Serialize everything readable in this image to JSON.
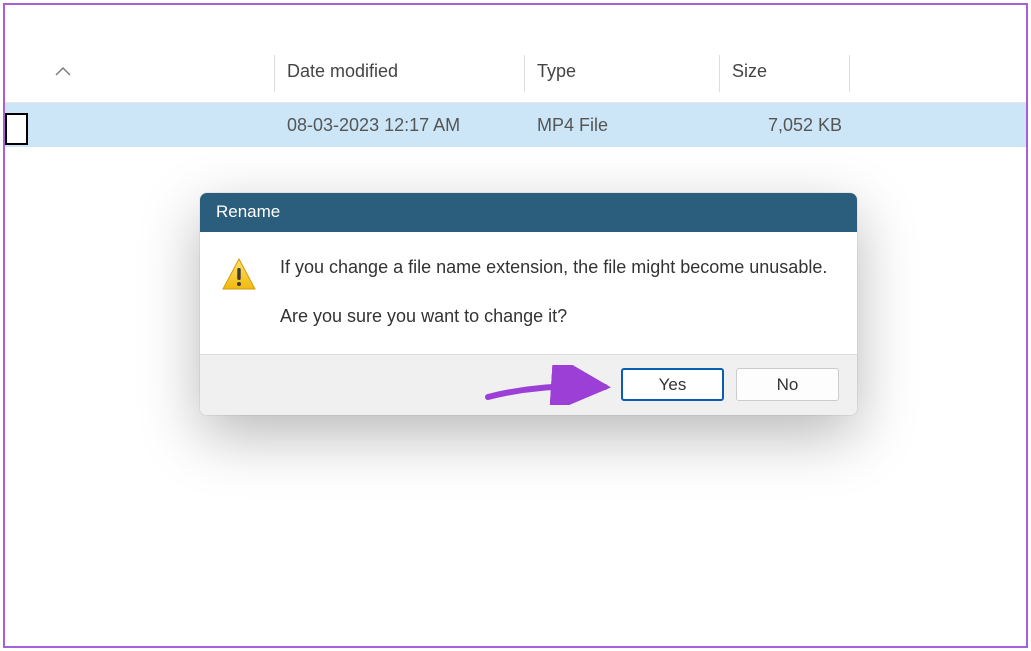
{
  "columns": {
    "name": "",
    "date": "Date modified",
    "type": "Type",
    "size": "Size"
  },
  "row": {
    "date": "08-03-2023 12:17 AM",
    "type": "MP4 File",
    "size": "7,052 KB"
  },
  "dialog": {
    "title": "Rename",
    "line1": "If you change a file name extension, the file might become unusable.",
    "line2": "Are you sure you want to change it?",
    "yes": "Yes",
    "no": "No"
  }
}
